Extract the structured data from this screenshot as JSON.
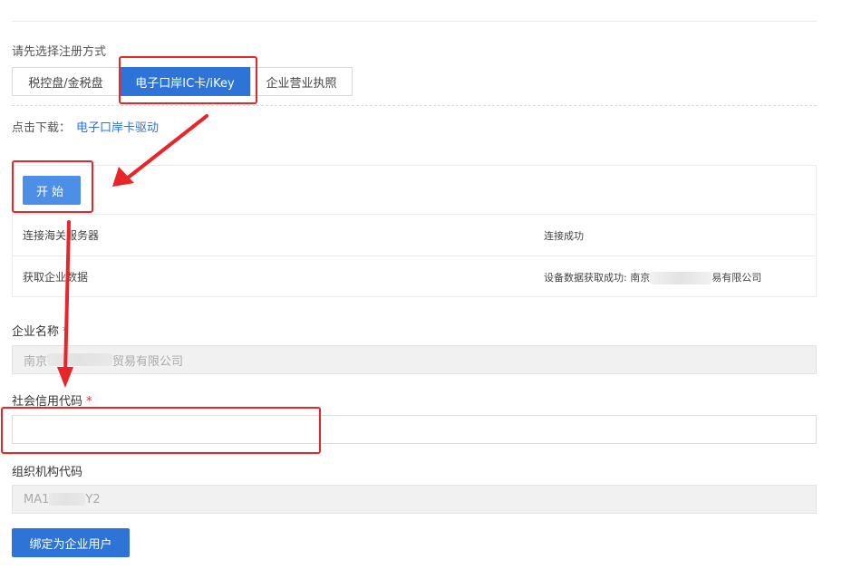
{
  "registration": {
    "prompt": "请先选择注册方式",
    "tabs": [
      {
        "label": "税控盘/金税盘",
        "active": false
      },
      {
        "label": "电子口岸IC卡/iKey",
        "active": true
      },
      {
        "label": "企业营业执照",
        "active": false
      }
    ]
  },
  "download": {
    "prefix": "点击下载：",
    "link_label": "电子口岸卡驱动"
  },
  "progress": {
    "start_label": "开始",
    "steps": [
      {
        "name": "连接海关服务器",
        "status": "连接成功"
      },
      {
        "name": "获取企业数据",
        "status_prefix": "设备数据获取成功: 南京",
        "status_suffix": "易有限公司"
      }
    ]
  },
  "form": {
    "company_name_label": "企业名称",
    "company_name_value_prefix": "南京",
    "company_name_value_suffix": "贸易有限公司",
    "credit_code_label": "社会信用代码",
    "credit_code_value": "",
    "org_code_label": "组织机构代码",
    "org_code_value_prefix": "MA1",
    "org_code_value_suffix": "Y2",
    "required_mark": "*",
    "submit_label": "绑定为企业用户"
  },
  "colors": {
    "primary": "#2e74d6",
    "start_button": "#4d8fe6",
    "required": "#e0332b",
    "annotation": "#e8262a"
  }
}
